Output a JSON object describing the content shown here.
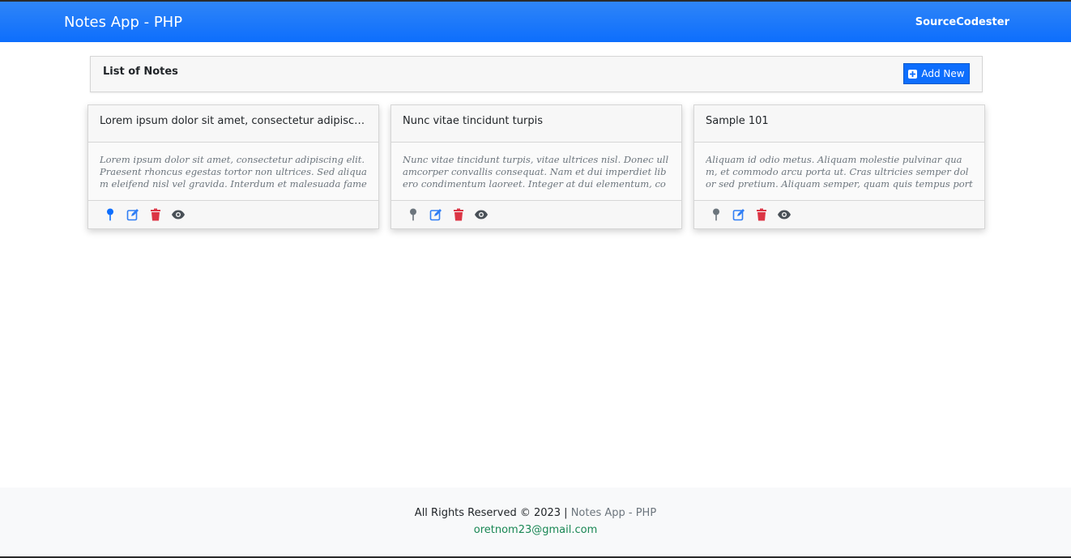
{
  "navbar": {
    "brand": "Notes App - PHP",
    "link": "SourceCodester"
  },
  "header": {
    "title": "List of Notes",
    "add_button": "Add New"
  },
  "notes": [
    {
      "title": "Lorem ipsum dolor sit amet, consectetur adipiscing elit.",
      "excerpt": "Lorem ipsum dolor sit amet, consectetur adipiscing elit. Praesent rhoncus egestas tortor non ultrices. Sed aliquam eleifend nisl vel gravida. Interdum et malesuada fames ac ante ipsum primis in faucibus.",
      "pinned": true
    },
    {
      "title": "Nunc vitae tincidunt turpis",
      "excerpt": "Nunc vitae tincidunt turpis, vitae ultrices nisl. Donec ullamcorper convallis consequat. Nam et dui imperdiet libero condimentum laoreet. Integer at dui elementum, consectetur.",
      "pinned": false
    },
    {
      "title": "Sample 101",
      "excerpt": "Aliquam id odio metus. Aliquam molestie pulvinar quam, et commodo arcu porta ut. Cras ultricies semper dolor sed pretium. Aliquam semper, quam quis tempus porta.",
      "pinned": false
    }
  ],
  "icons": {
    "pin": "pin-icon",
    "edit": "edit-icon",
    "delete": "trash-icon",
    "view": "eye-icon"
  },
  "colors": {
    "primary": "#0d6efd",
    "pin_active": "#0d6efd",
    "pin_inactive": "#6c757d",
    "edit": "#2f7ef5",
    "delete": "#dc3545",
    "view": "#495057",
    "email": "#198754"
  },
  "footer": {
    "rights": "All Rights Reserved © 2023 | ",
    "app_name": "Notes App - PHP",
    "email": "oretnom23@gmail.com"
  }
}
